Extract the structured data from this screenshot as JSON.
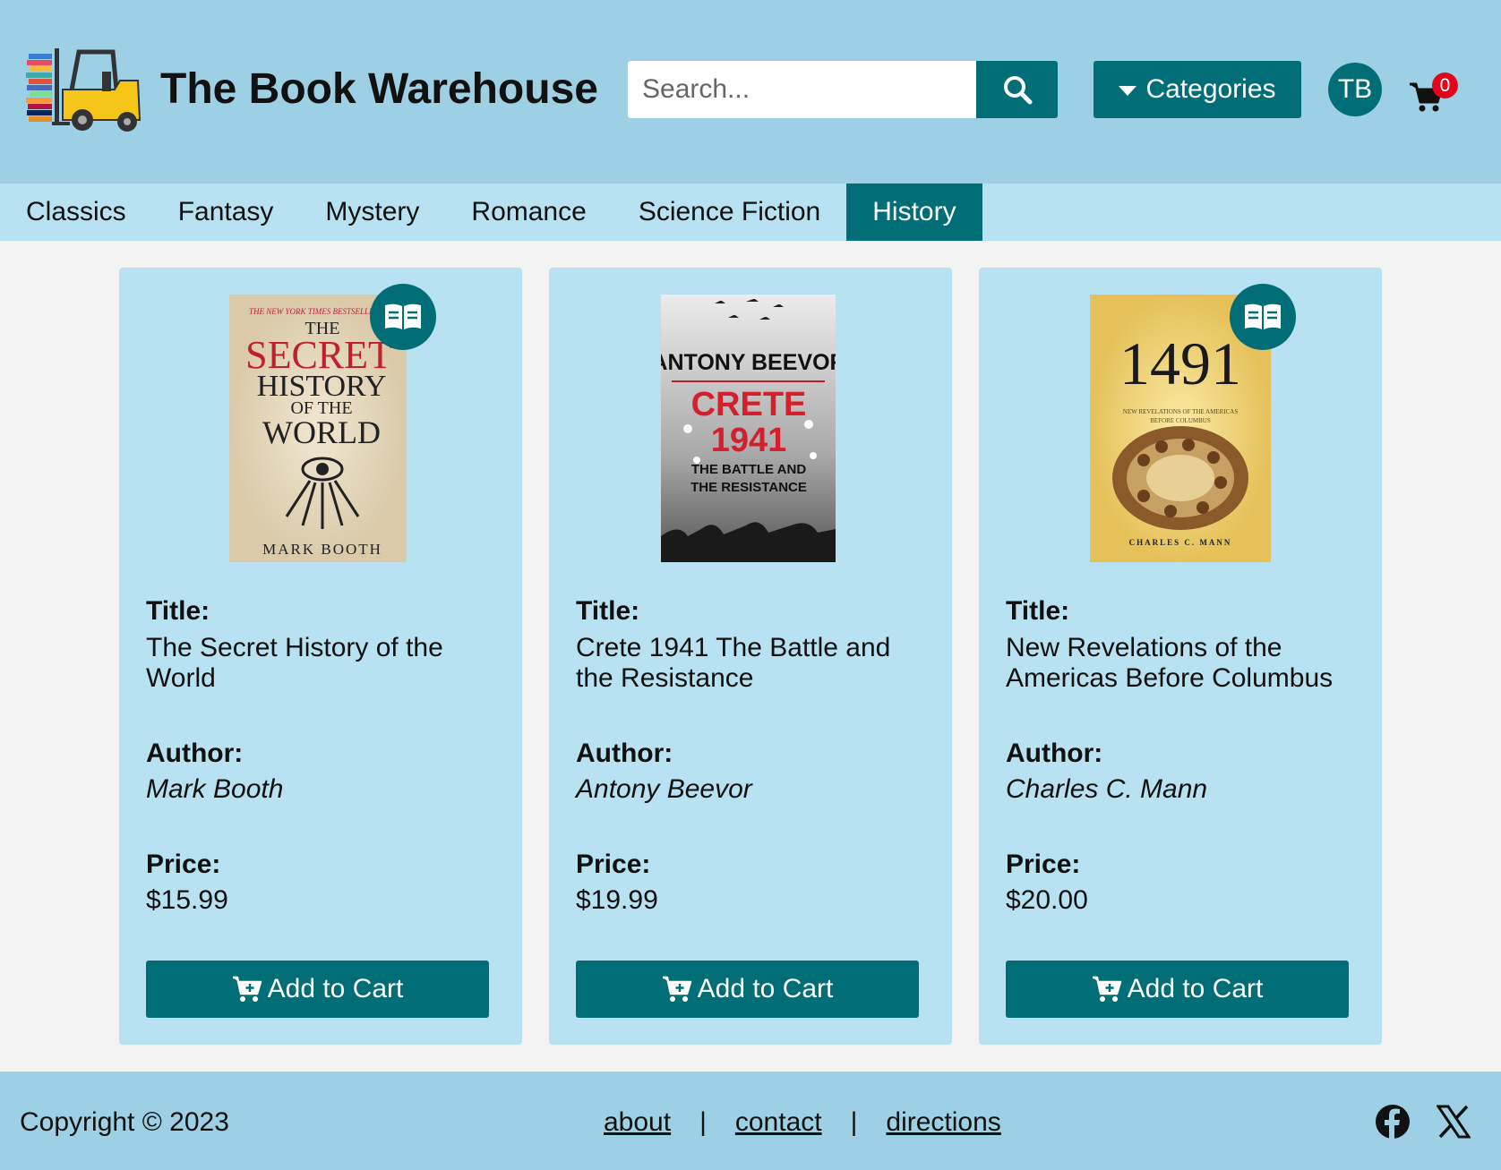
{
  "header": {
    "title": "The Book Warehouse",
    "search_placeholder": "Search...",
    "categories_label": "Categories",
    "avatar_initials": "TB",
    "cart_count": "0"
  },
  "nav": {
    "items": [
      "Classics",
      "Fantasy",
      "Mystery",
      "Romance",
      "Science Fiction",
      "History"
    ],
    "active": "History"
  },
  "labels": {
    "title": "Title:",
    "author": "Author:",
    "price": "Price:",
    "add_to_cart": "Add to Cart"
  },
  "books": [
    {
      "cover_top": "THE NEW YORK TIMES BESTSELLER",
      "cover_title": [
        "THE",
        "SECRET",
        "HISTORY",
        "OF THE",
        "WORLD"
      ],
      "cover_author": "MARK BOOTH",
      "title": "The Secret History of the World",
      "author": "Mark Booth",
      "price": "$15.99",
      "has_badge": true
    },
    {
      "cover_author": "ANTONY BEEVOR",
      "cover_title": [
        "CRETE",
        "1941"
      ],
      "cover_subtitle": [
        "THE BATTLE AND",
        "THE RESISTANCE"
      ],
      "title": "Crete 1941 The Battle and the Resistance",
      "author": "Antony Beevor",
      "price": "$19.99",
      "has_badge": false
    },
    {
      "cover_title": [
        "1491"
      ],
      "cover_subtitle": [
        "NEW REVELATIONS OF THE AMERICAS",
        "BEFORE COLUMBUS"
      ],
      "cover_author": "CHARLES C. MANN",
      "title": "New Revelations of the Americas Before Columbus",
      "author": "Charles C. Mann",
      "price": "$20.00",
      "has_badge": true
    }
  ],
  "footer": {
    "copyright": "Copyright © 2023",
    "links": [
      "about",
      "contact",
      "directions"
    ],
    "separator": "|"
  },
  "colors": {
    "header_bg": "#9dcfe5",
    "nav_bg": "#b8e1f2",
    "accent": "#016e77",
    "badge_red": "#e0061b"
  }
}
